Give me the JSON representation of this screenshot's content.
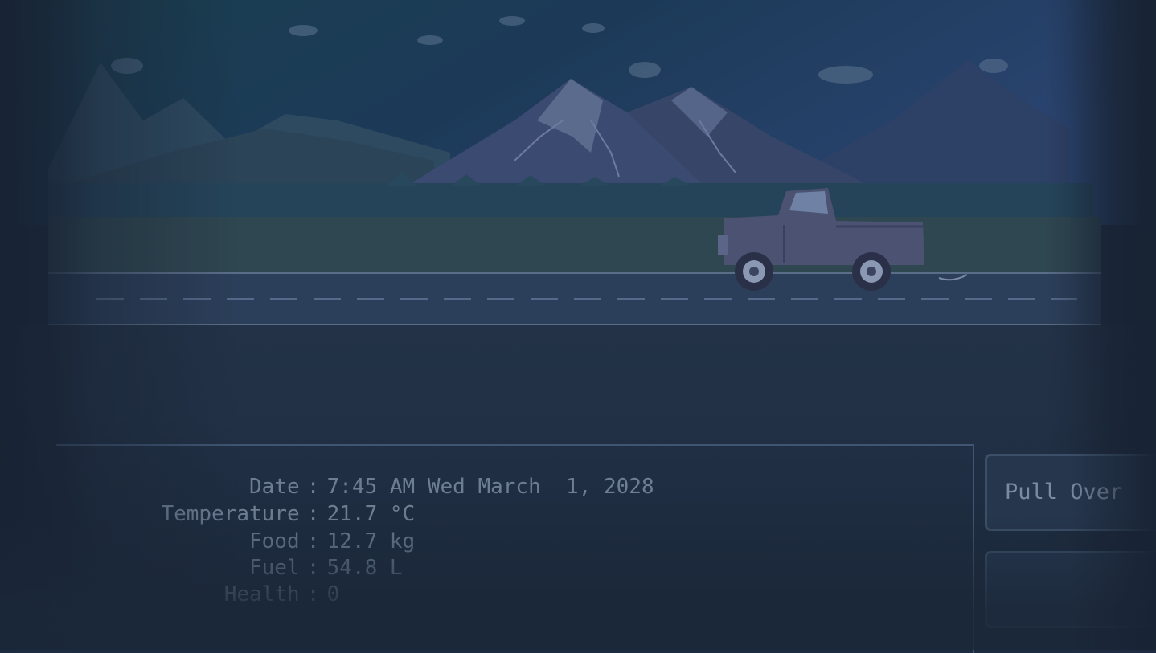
{
  "stats": [
    {
      "label": "Date",
      "value": "7:45 AM Wed March  1, 2028"
    },
    {
      "label": "Temperature",
      "value": "21.7 °C"
    },
    {
      "label": "Food",
      "value": "12.7 kg"
    },
    {
      "label": "Fuel",
      "value": "54.8 L"
    },
    {
      "label": "Health",
      "value": "0"
    }
  ],
  "buttons": {
    "pull_over_label": "Pull Over"
  },
  "colors": {
    "sky_top": "#1a3a52",
    "sky_right": "#2a4670",
    "grass": "#2f4750",
    "road": "#2b3e58",
    "truck": "#4a5470",
    "stat_text": "#6d7e92",
    "panel_border": "#3f5571"
  },
  "icons": {
    "vehicle": "pickup-truck",
    "background": "mountain-landscape"
  }
}
